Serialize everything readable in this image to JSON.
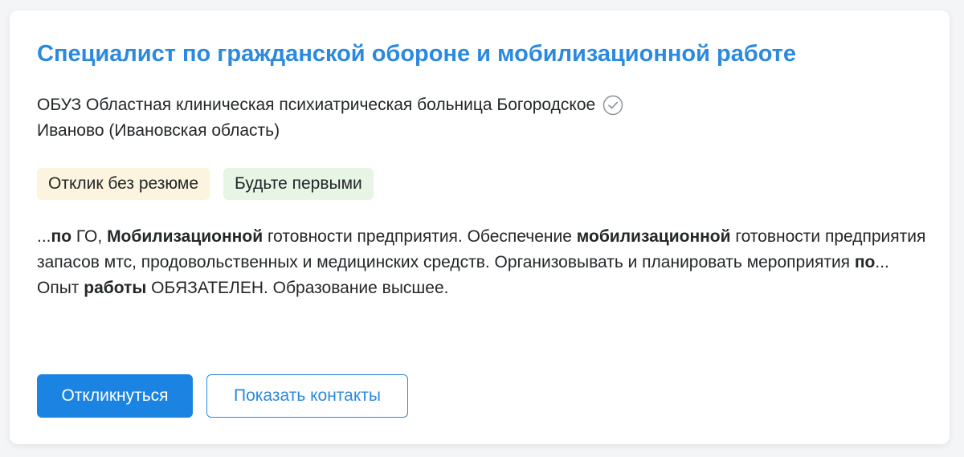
{
  "vacancy": {
    "title": "Специалист по гражданской обороне и мобилизационной работе",
    "company": "ОБУЗ Областная клиническая психиатрическая больница Богородское",
    "company_icon": "verified-check-icon",
    "location": "Иваново (Ивановская область)",
    "tags": [
      "Отклик без резюме",
      "Будьте первыми"
    ],
    "snippet": {
      "line1": [
        {
          "text": "...",
          "bold": false
        },
        {
          "text": "по",
          "bold": true
        },
        {
          "text": " ГО, ",
          "bold": false
        },
        {
          "text": "Мобилизационной",
          "bold": true
        },
        {
          "text": " готовности предприятия. Обеспечение ",
          "bold": false
        },
        {
          "text": "мобилизационной",
          "bold": true
        },
        {
          "text": " готовности предприятия запасов мтс, продовольственных и медицинских средств. Организовывать и планировать мероприятия ",
          "bold": false
        },
        {
          "text": "по",
          "bold": true
        },
        {
          "text": "...",
          "bold": false
        }
      ],
      "line2": [
        {
          "text": "Опыт ",
          "bold": false
        },
        {
          "text": "работы",
          "bold": true
        },
        {
          "text": " ОБЯЗАТЕЛЕН. Образование высшее.",
          "bold": false
        }
      ]
    },
    "buttons": {
      "respond": "Откликнуться",
      "show_contacts": "Показать контакты"
    }
  },
  "colors": {
    "accent": "#2b89df",
    "primary_button": "#1b84e3",
    "tag_no_resume_bg": "#fdf4df",
    "tag_be_first_bg": "#e7f6e4"
  }
}
